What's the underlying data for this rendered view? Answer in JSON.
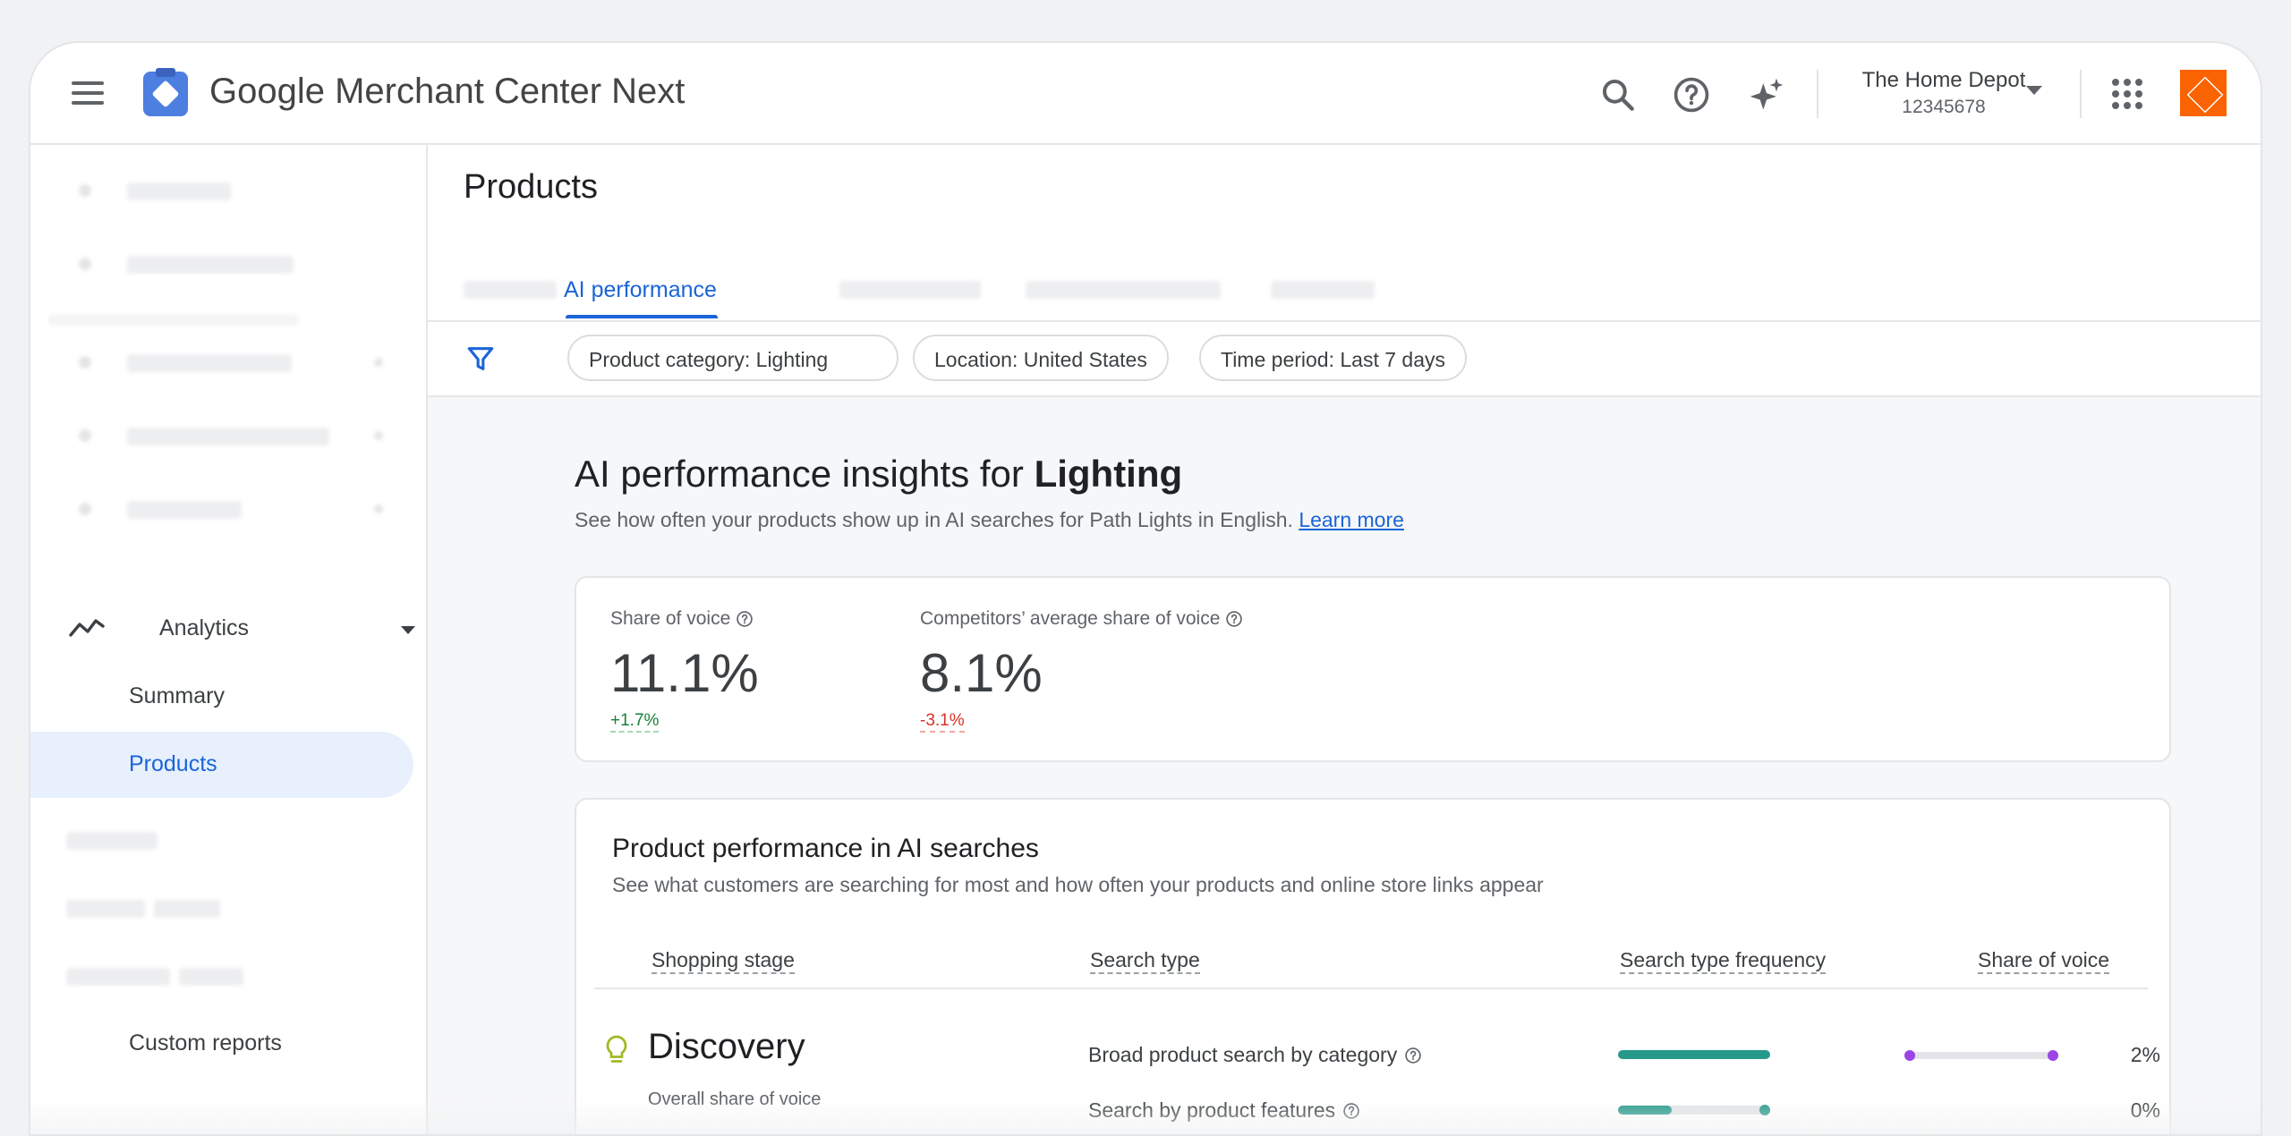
{
  "header": {
    "app_title_brand": "Google",
    "app_title_product": "Merchant Center Next",
    "account_name": "The Home Depot",
    "account_id": "12345678"
  },
  "sidebar": {
    "analytics_label": "Analytics",
    "items": [
      {
        "label": "Summary",
        "active": false
      },
      {
        "label": "Products",
        "active": true
      },
      {
        "label": "Custom reports",
        "active": false
      }
    ]
  },
  "main": {
    "page_title": "Products",
    "active_tab": "AI performance",
    "filters": [
      "Product category: Lighting",
      "Location: United States",
      "Time period: Last 7 days"
    ],
    "insights": {
      "title_prefix": "AI performance insights for",
      "title_category": "Lighting",
      "subtitle": "See how often your products show up in AI searches for Path Lights in English.",
      "learn_more": "Learn more"
    },
    "metrics": [
      {
        "label": "Share of voice",
        "value": "11.1%",
        "delta": "+1.7%",
        "direction": "positive"
      },
      {
        "label": "Competitors’ average share of voice",
        "value": "8.1%",
        "delta": "-3.1%",
        "direction": "negative"
      }
    ],
    "performance": {
      "title": "Product performance in AI searches",
      "subtitle": "See what customers are searching for most and how often your products and online store links appear",
      "columns": [
        "Shopping stage",
        "Search type",
        "Search type frequency",
        "Share of voice"
      ],
      "stage_name": "Discovery",
      "stage_sub": "Overall share of voice",
      "rows": [
        {
          "search_type": "Broad product search by category",
          "frequency": 1.0,
          "sov_start": 0.0,
          "sov_end": 1.0,
          "share_of_voice": "2%"
        },
        {
          "search_type": "Search by product features",
          "frequency": 0.35,
          "sov_start": null,
          "sov_end": null,
          "share_of_voice": "0%"
        }
      ]
    }
  },
  "colors": {
    "accent": "#1a64d8",
    "teal": "#26998a",
    "purple": "#9b45e4",
    "positive": "#188038",
    "negative": "#d93025",
    "brand_orange": "#f96302"
  },
  "icons": [
    "menu-icon",
    "merchant-center-logo-icon",
    "search-icon",
    "help-icon",
    "sparkle-icon",
    "dropdown-caret-icon",
    "apps-grid-icon",
    "filter-icon",
    "analytics-trend-icon",
    "info-icon",
    "lightbulb-icon"
  ]
}
